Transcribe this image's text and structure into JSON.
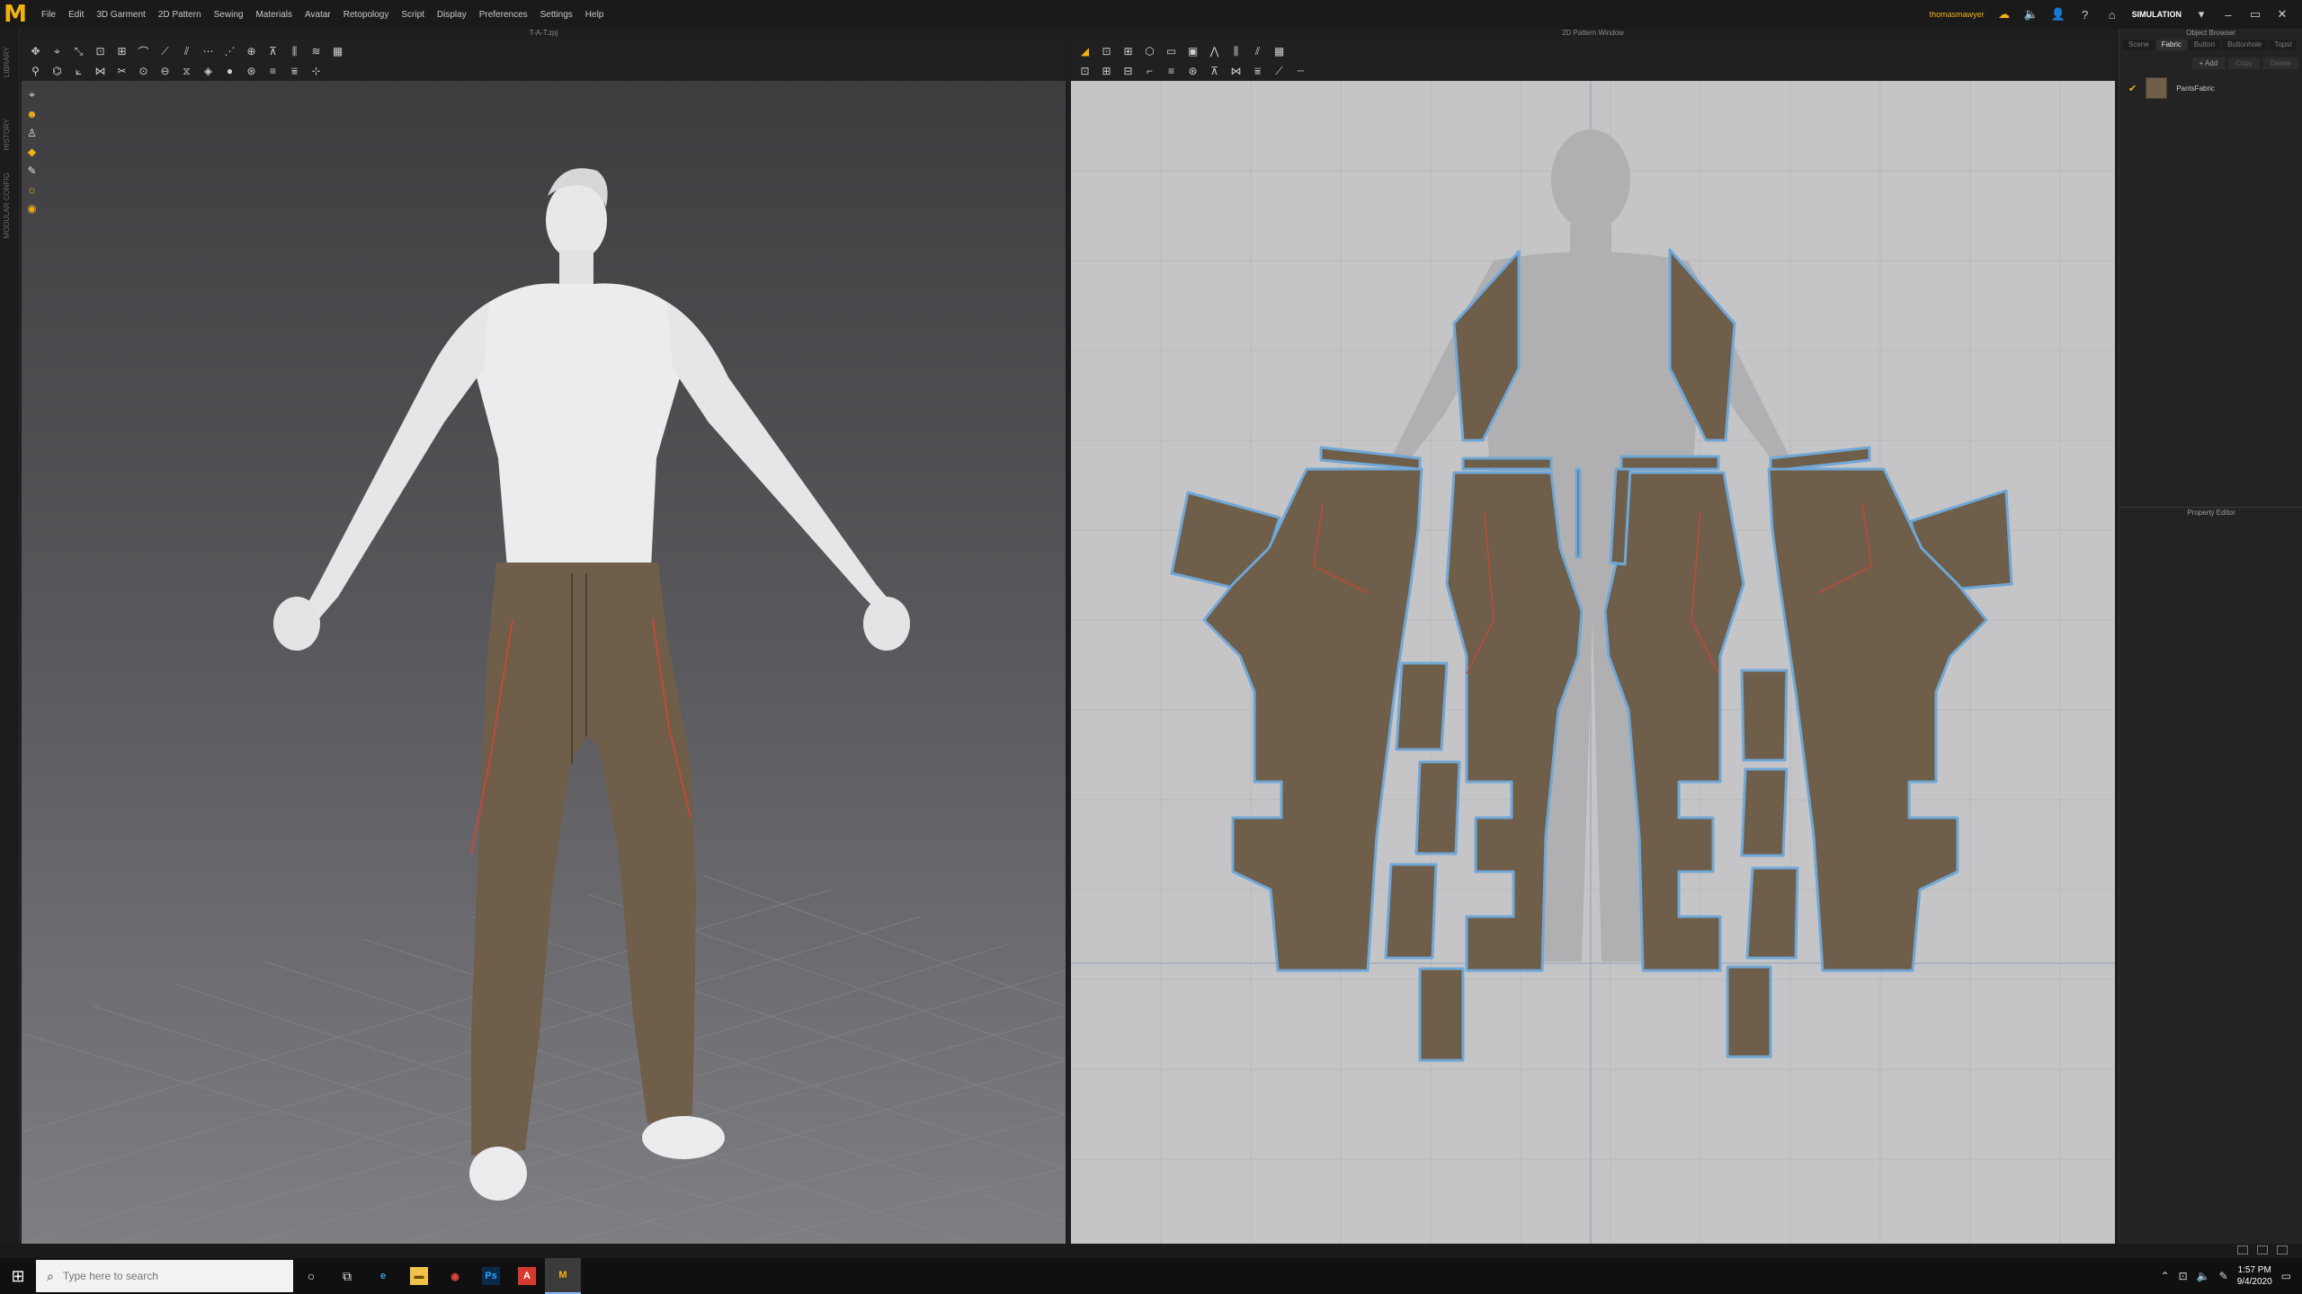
{
  "menubar": {
    "items": [
      "File",
      "Edit",
      "3D Garment",
      "2D Pattern",
      "Sewing",
      "Materials",
      "Avatar",
      "Retopology",
      "Script",
      "Display",
      "Preferences",
      "Settings",
      "Help"
    ],
    "user_name": "thomasmawyer",
    "mode_label": "SIMULATION"
  },
  "left_strip": {
    "labels": [
      "LIBRARY",
      "HISTORY",
      "MODULAR CONFIG"
    ]
  },
  "view3d": {
    "title": "T-A-T.zpj"
  },
  "view2d": {
    "title": "2D Pattern Window"
  },
  "object_browser": {
    "title": "Object Browser",
    "tabs": [
      "Scene",
      "Fabric",
      "Button",
      "Buttonhole",
      "Topst"
    ],
    "active_tab": "Fabric",
    "add_label": "+ Add",
    "copy_label": "Copy",
    "delete_label": "Delete",
    "fabric": {
      "name": "PantsFabric",
      "color": "#6f5e49"
    }
  },
  "property_editor": {
    "title": "Property Editor"
  },
  "colors": {
    "accent": "#f3b112",
    "fabric": "#6f5e49",
    "pattern_outline": "#6fa7d6",
    "seam_line": "#c24a3a"
  },
  "taskbar": {
    "search_placeholder": "Type here to search",
    "time": "1:57 PM",
    "date": "9/4/2020"
  }
}
